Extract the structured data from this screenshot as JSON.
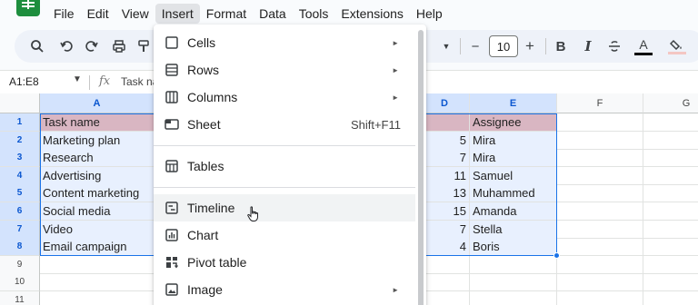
{
  "menubar": {
    "items": [
      "File",
      "Edit",
      "View",
      "Insert",
      "Format",
      "Data",
      "Tools",
      "Extensions",
      "Help"
    ],
    "active": "Insert"
  },
  "toolbar": {
    "font_size": "10",
    "icons": [
      "search-icon",
      "undo-icon",
      "redo-icon",
      "print-icon",
      "paint-format-icon",
      "chevron-down-icon",
      "minus-icon",
      "plus-icon",
      "bold-icon",
      "italic-icon",
      "strikethrough-icon",
      "text-color-icon",
      "fill-color-icon"
    ],
    "bold_label": "B",
    "italic_label": "I",
    "text_color_label": "A",
    "minus_label": "−",
    "plus_label": "+",
    "accent_color": "#1a73e8"
  },
  "formula_bar": {
    "name_box": "A1:E8",
    "fx_label": "fx",
    "content": "Task na"
  },
  "columns": [
    "A",
    "D",
    "E",
    "F",
    "G"
  ],
  "rows": [
    "1",
    "2",
    "3",
    "4",
    "5",
    "6",
    "7",
    "8",
    "9",
    "10",
    "11"
  ],
  "table": {
    "col_a": [
      "Task name",
      "Marketing plan",
      "Research",
      "Advertising",
      "Content marketing",
      "Social media",
      "Video",
      "Email campaign"
    ],
    "col_d": [
      "",
      "5",
      "7",
      "11",
      "13",
      "15",
      "7",
      "4"
    ],
    "col_e": [
      "Assignee",
      "Mira",
      "Mira",
      "Samuel",
      "Muhammed",
      "Amanda",
      "Stella",
      "Boris"
    ]
  },
  "insert_menu": {
    "items": [
      {
        "label": "Cells",
        "icon": "cells-icon",
        "submenu": true
      },
      {
        "label": "Rows",
        "icon": "rows-icon",
        "submenu": true
      },
      {
        "label": "Columns",
        "icon": "columns-icon",
        "submenu": true
      },
      {
        "label": "Sheet",
        "icon": "sheet-icon",
        "shortcut": "Shift+F11"
      },
      {
        "label": "Tables",
        "icon": "tables-icon"
      },
      {
        "label": "Timeline",
        "icon": "timeline-icon",
        "hovered": true
      },
      {
        "label": "Chart",
        "icon": "chart-icon"
      },
      {
        "label": "Pivot table",
        "icon": "pivot-table-icon"
      },
      {
        "label": "Image",
        "icon": "image-icon",
        "submenu": true
      }
    ]
  },
  "colors": {
    "header_fill": "#d9b6c2",
    "selection_fill": "#e8f0fe",
    "selection_border": "#1a73e8",
    "sheets_green": "#1e8e3e"
  }
}
